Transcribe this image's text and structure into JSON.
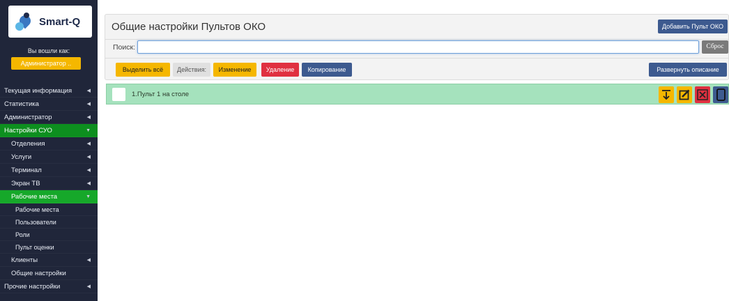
{
  "brand": {
    "name": "Smart-Q"
  },
  "user": {
    "logged_label": "Вы вошли как:",
    "role_button": "Администратор .."
  },
  "nav": [
    {
      "label": "Текущая информация",
      "level": 0,
      "caret": "◀",
      "state": ""
    },
    {
      "label": "Статистика",
      "level": 0,
      "caret": "◀",
      "state": ""
    },
    {
      "label": "Администратор",
      "level": 0,
      "caret": "◀",
      "state": ""
    },
    {
      "label": "Настройки СУО",
      "level": 0,
      "caret": "▼",
      "state": "active"
    },
    {
      "label": "Отделения",
      "level": 1,
      "caret": "◀",
      "state": ""
    },
    {
      "label": "Услуги",
      "level": 1,
      "caret": "◀",
      "state": ""
    },
    {
      "label": "Терминал",
      "level": 1,
      "caret": "◀",
      "state": ""
    },
    {
      "label": "Экран ТВ",
      "level": 1,
      "caret": "◀",
      "state": ""
    },
    {
      "label": "Рабочие места",
      "level": 1,
      "caret": "▼",
      "state": "active-sub"
    },
    {
      "label": "Рабочие места",
      "level": 2,
      "caret": "",
      "state": ""
    },
    {
      "label": "Пользователи",
      "level": 2,
      "caret": "",
      "state": ""
    },
    {
      "label": "Роли",
      "level": 2,
      "caret": "",
      "state": ""
    },
    {
      "label": "Пульт оценки",
      "level": 2,
      "caret": "",
      "state": ""
    },
    {
      "label": "Клиенты",
      "level": 1,
      "caret": "◀",
      "state": ""
    },
    {
      "label": "Общие настройки",
      "level": 1,
      "caret": "",
      "state": ""
    },
    {
      "label": "Прочие настройки",
      "level": 0,
      "caret": "◀",
      "state": ""
    }
  ],
  "main": {
    "title": "Общие настройки Пультов ОКО",
    "add_button": "Добавить Пульт ОКО",
    "search": {
      "label": "Поиск:",
      "value": "",
      "reset": "Сброс"
    },
    "toolbar": {
      "select_all": "Выделить всё",
      "actions": "Действия:",
      "edit": "Изменение",
      "delete": "Удаление",
      "copy": "Копирование",
      "expand": "Развернуть описание"
    },
    "rows": [
      {
        "label": "1.Пульт 1 на столе"
      }
    ]
  },
  "colors": {
    "sidebar": "#20263a",
    "active_green": "#0d8f1f",
    "accent_yellow": "#f5b700",
    "danger_red": "#e03040",
    "primary_blue": "#3d5a8f",
    "row_green": "#a5e2bd"
  }
}
